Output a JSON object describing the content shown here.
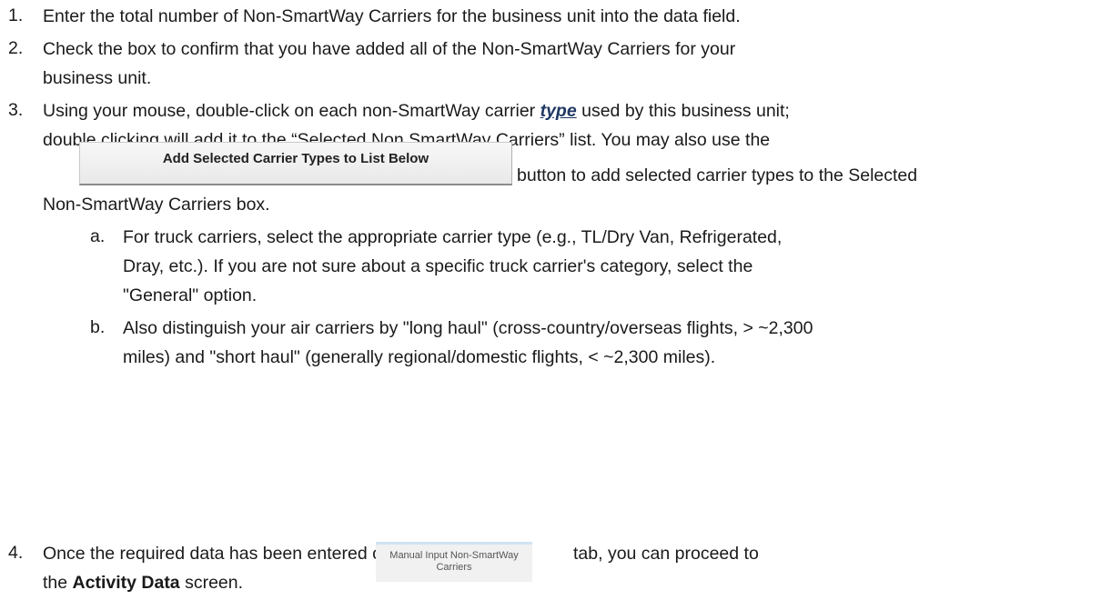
{
  "steps": [
    {
      "num": "1.",
      "lines": [
        "Enter the total number of Non-SmartWay Carriers for the business unit into the data field."
      ]
    },
    {
      "num": "2.",
      "lines": [
        "Check the box to confirm that you have added all of the Non-SmartWay Carriers for your",
        "business unit."
      ]
    },
    {
      "num": "3.",
      "line1_pre": "Using your mouse, double-click on each non-SmartWay carrier ",
      "line1_emph": "type",
      "line1_post": " used by this business unit;",
      "line2": "double clicking will add it to the “Selected Non SmartWay Carriers” list. You may also use the",
      "button_label": "Add Selected Carrier Types to List Below",
      "line3_after_button": "button to add selected carrier types to the Selected",
      "line4": "Non-SmartWay Carriers box.",
      "sub": [
        {
          "letter": "a.",
          "lines": [
            "For truck carriers, select the appropriate carrier type (e.g., TL/Dry Van, Refrigerated,",
            "Dray, etc.). If you are not sure about a specific truck carrier's category, select the",
            "\"General\" option."
          ]
        },
        {
          "letter": "b.",
          "lines": [
            "Also distinguish your air carriers by \"long haul\" (cross-country/overseas flights, > ~2,300",
            "miles) and \"short haul\" (generally regional/domestic flights, < ~2,300 miles)."
          ]
        }
      ]
    },
    {
      "num": "4.",
      "line1_pre": "Once the required data has been entered on the",
      "tab_line1": "Manual Input Non-SmartWay",
      "tab_line2": "Carriers",
      "line1_post": "tab, you can proceed to",
      "line2_pre": "the ",
      "line2_bold": "Activity Data",
      "line2_post": " screen."
    }
  ]
}
